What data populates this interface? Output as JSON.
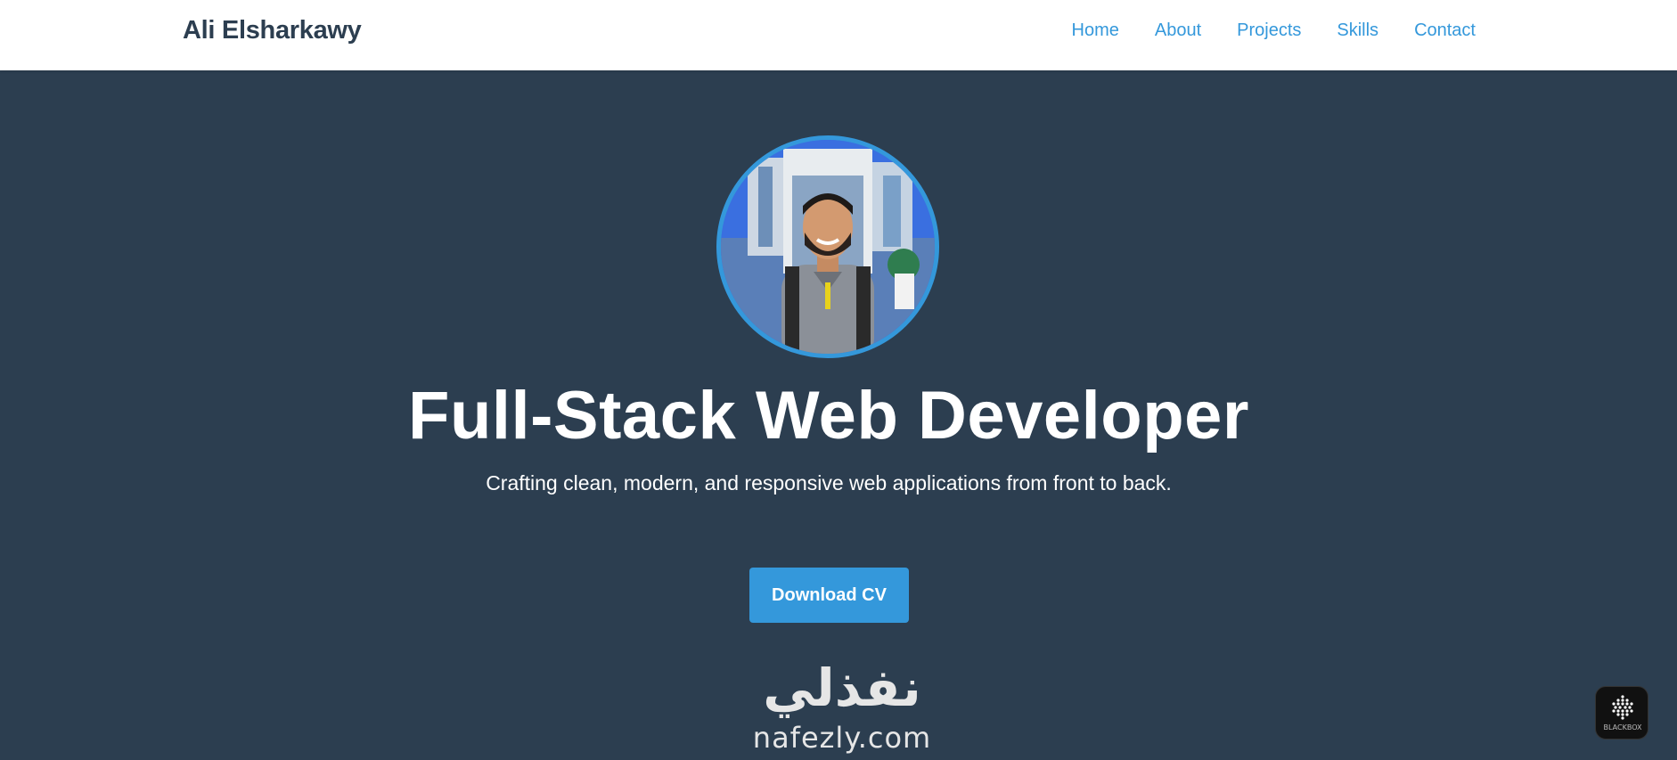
{
  "header": {
    "brand": "Ali Elsharkawy",
    "nav": [
      "Home",
      "About",
      "Projects",
      "Skills",
      "Contact"
    ]
  },
  "hero": {
    "title": "Full-Stack Web Developer",
    "subtitle": "Crafting clean, modern, and responsive web applications from front to back.",
    "cta_label": "Download CV",
    "avatar_icon": "profile-photo"
  },
  "watermark": {
    "arabic": "نفذلي",
    "latin": "nafezly.com"
  },
  "badge": {
    "label": "BLACKBOX",
    "icon": "blackbox-logo-icon"
  },
  "colors": {
    "background": "#2c3e50",
    "accent": "#3498db",
    "navbar": "#ffffff",
    "text": "#ffffff"
  }
}
